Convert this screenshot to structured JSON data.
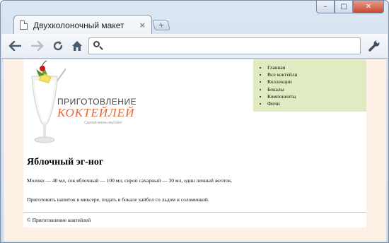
{
  "browser": {
    "tab_title": "Двухколоночный макет",
    "tab_close": "×",
    "new_tab": "+",
    "address_value": "",
    "controls": {
      "minimize": "–",
      "maximize": "□",
      "close": "✕"
    },
    "nav_glyphs": {
      "back": "🡐",
      "forward": "🡒",
      "reload": "↻",
      "home": "⌂",
      "wrench": "🔧"
    }
  },
  "page": {
    "logo": {
      "title": "ПРИГОТОВЛЕНИЕ",
      "subtitle": "КОКТЕЙЛЕЙ",
      "tagline": "Сделай жизнь вкуснее!"
    },
    "nav_items": [
      "Главная",
      "Все коктейли",
      "Коллекции",
      "Бокалы",
      "Компоненты",
      "Фичи"
    ],
    "article": {
      "title": "Яблочный эг-ног",
      "paragraph1": "Молоко — 40 мл, сок яблочный — 100 мл, сироп сахарный — 30 мл, один личный желток.",
      "paragraph2": "Приготовить напиток в миксере, подать в бокале хайбол со льдом и соломинкой."
    },
    "footer": "© Приготовление коктейлей"
  },
  "colors": {
    "page_bg": "#fdf0e4",
    "nav_bg": "#e0ebc1",
    "logo_accent": "#e06a3c"
  }
}
